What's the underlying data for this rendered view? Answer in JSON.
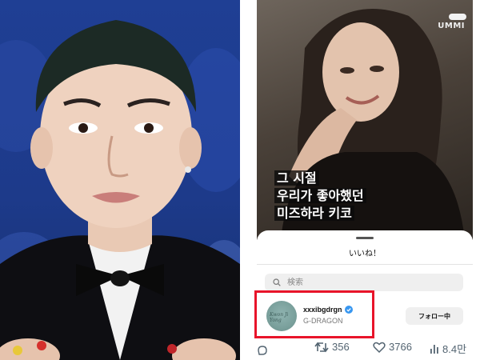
{
  "left_photo": {
    "description_icon": "portrait-photo"
  },
  "video": {
    "watermark": "UMMI",
    "caption_lines": [
      "그 시절",
      "우리가 좋아했던",
      "미즈하라 키코"
    ]
  },
  "likes_sheet": {
    "title": "いいね！",
    "search_placeholder": "検索",
    "user": {
      "username": "xxxibgdrgn",
      "full_name": "G-DRAGON",
      "verified": true,
      "follow_label": "フォロー中",
      "avatar_signature": "Kwon Ji Yong"
    }
  },
  "stats": {
    "reposts": "356",
    "likes": "3766",
    "views": "8.4만"
  },
  "colors": {
    "highlight": "#e8142a",
    "verified": "#3897f0",
    "stat_gray": "#536471"
  }
}
